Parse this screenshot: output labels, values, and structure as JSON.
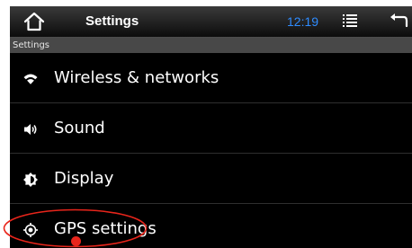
{
  "status_bar": {
    "title": "Settings",
    "time": "12:19",
    "home_icon": "home-icon",
    "menu_icon": "menu-icon",
    "back_icon": "back-icon",
    "time_color": "#2f8cff"
  },
  "section": {
    "header": "Settings"
  },
  "settings_items": [
    {
      "label": "Wireless & networks",
      "icon": "wifi-icon"
    },
    {
      "label": "Sound",
      "icon": "speaker-icon"
    },
    {
      "label": "Display",
      "icon": "brightness-icon"
    },
    {
      "label": "GPS settings",
      "icon": "location-icon"
    }
  ],
  "annotation": {
    "highlighted_item": "GPS settings",
    "highlight_color": "#e8251b"
  }
}
